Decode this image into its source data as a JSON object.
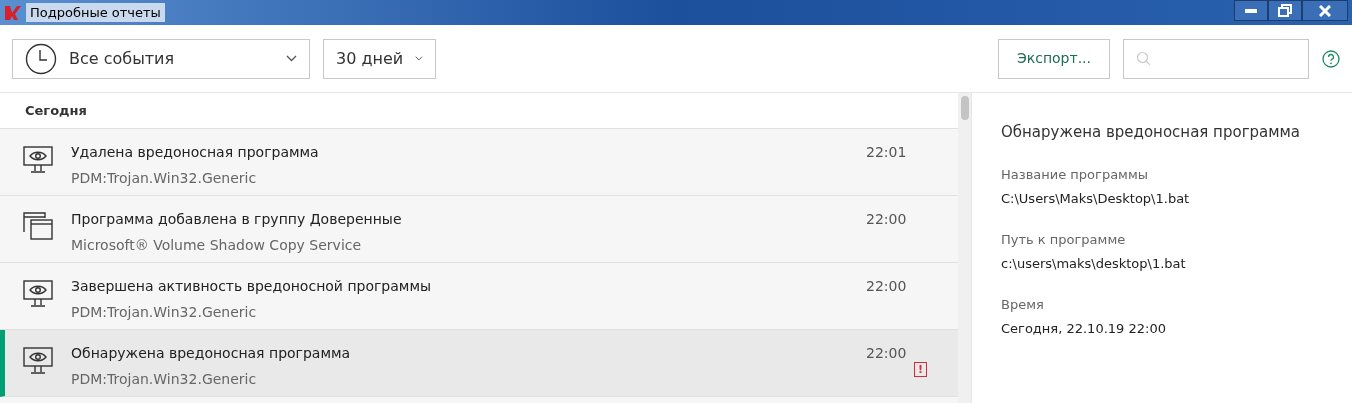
{
  "window": {
    "title": "Подробные отчеты"
  },
  "toolbar": {
    "event_filter": "Все события",
    "period_filter": "30 дней",
    "export_button": "Экспорт..."
  },
  "list": {
    "group_header": "Сегодня",
    "rows": [
      {
        "kind": "monitor",
        "title": "Удалена вредоносная программа",
        "subtitle": "PDM:Trojan.Win32.Generic",
        "time": "22:01",
        "selected": false
      },
      {
        "kind": "windows",
        "title": "Программа добавлена в группу Доверенные",
        "subtitle": "Microsoft® Volume Shadow Copy Service",
        "time": "22:00",
        "selected": false
      },
      {
        "kind": "monitor",
        "title": "Завершена активность вредоносной программы",
        "subtitle": "PDM:Trojan.Win32.Generic",
        "time": "22:00",
        "selected": false
      },
      {
        "kind": "monitor",
        "title": "Обнаружена вредоносная программа",
        "subtitle": "PDM:Trojan.Win32.Generic",
        "time": "22:00",
        "selected": true,
        "badge": "!"
      }
    ]
  },
  "details": {
    "title": "Обнаружена вредоносная программа",
    "fields": [
      {
        "label": "Название программы",
        "value": "C:\\Users\\Maks\\Desktop\\1.bat"
      },
      {
        "label": "Путь к программе",
        "value": "c:\\users\\maks\\desktop\\1.bat"
      },
      {
        "label": "Время",
        "value": "Сегодня, 22.10.19 22:00"
      }
    ]
  }
}
